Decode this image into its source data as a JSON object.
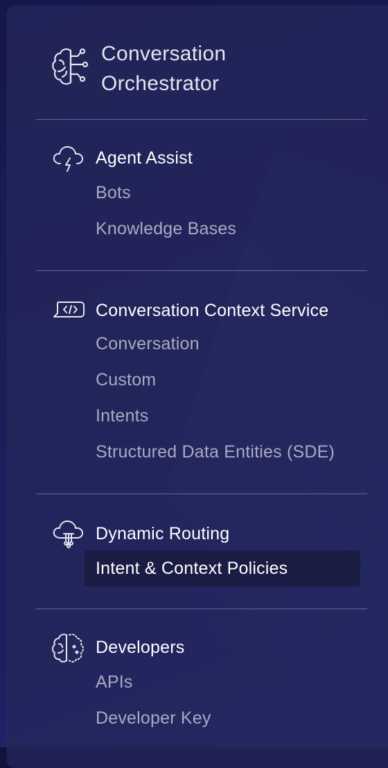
{
  "brand": {
    "line1": "Conversation",
    "line2": "Orchestrator",
    "icon": "brain-circuit-icon"
  },
  "sections": [
    {
      "title": "Agent Assist",
      "icon": "cloud-bolt-icon",
      "items": [
        "Bots",
        "Knowledge Bases"
      ]
    },
    {
      "title": "Conversation Context Service",
      "icon": "code-chat-bubble-icon",
      "items": [
        "Conversation",
        "Custom",
        "Intents",
        "Structured Data Entities (SDE)"
      ]
    },
    {
      "title": "Dynamic Routing",
      "icon": "cloud-routing-icon",
      "items": [
        "Intent & Context Policies"
      ],
      "active_item": "Intent & Context Policies"
    },
    {
      "title": "Developers",
      "icon": "developer-brain-icon",
      "items": [
        "APIs",
        "Developer Key"
      ]
    }
  ],
  "colors": {
    "background": "#1a1d55",
    "panel": "#26285c",
    "title_text": "#ffffff",
    "item_text": "#a8aac3",
    "active_bg": "#1a1b40"
  }
}
